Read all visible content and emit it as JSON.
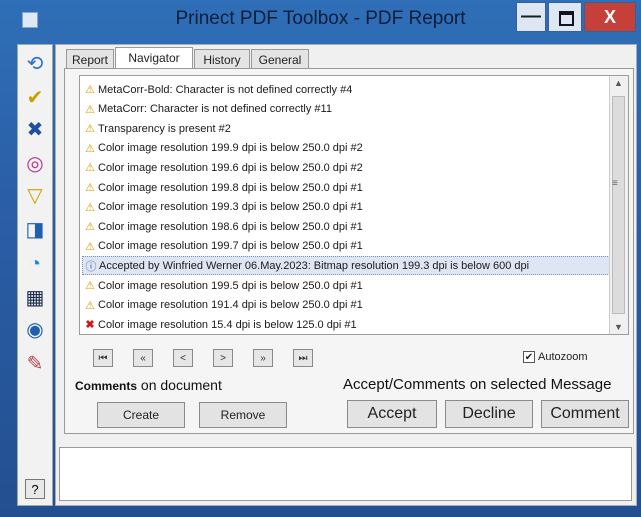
{
  "window": {
    "title": "Prinect PDF Toolbox - PDF Report",
    "minimize_label": "—",
    "close_label": "X"
  },
  "tabs": [
    {
      "label": "Report"
    },
    {
      "label": "Navigator"
    },
    {
      "label": "History"
    },
    {
      "label": "General"
    }
  ],
  "active_tab": "Navigator",
  "messages": [
    {
      "type": "warning",
      "text": "MetaCorr-Bold: Character is not defined correctly #4"
    },
    {
      "type": "warning",
      "text": "MetaCorr: Character is not defined correctly #11"
    },
    {
      "type": "warning",
      "text": "Transparency is present #2"
    },
    {
      "type": "warning",
      "text": "Color image resolution 199.9 dpi is below 250.0 dpi #2"
    },
    {
      "type": "warning",
      "text": "Color image resolution 199.6 dpi is below 250.0 dpi #2"
    },
    {
      "type": "warning",
      "text": "Color image resolution 199.8 dpi is below 250.0 dpi #1"
    },
    {
      "type": "warning",
      "text": "Color image resolution 199.3 dpi is below 250.0 dpi #1"
    },
    {
      "type": "warning",
      "text": "Color image resolution 198.6 dpi is below 250.0 dpi #1"
    },
    {
      "type": "warning",
      "text": "Color image resolution 199.7 dpi is below 250.0 dpi #1"
    },
    {
      "type": "accepted",
      "text": "Accepted by Winfried Werner 06.May.2023: Bitmap resolution 199.3 dpi is below 600 dpi"
    },
    {
      "type": "warning",
      "text": "Color image resolution 199.5 dpi is below 250.0 dpi #1"
    },
    {
      "type": "warning",
      "text": "Color image resolution 191.4 dpi is below 250.0 dpi #1"
    },
    {
      "type": "error",
      "text": "Color image resolution 15.4 dpi is below 125.0 dpi #1"
    }
  ],
  "icons": {
    "warning": "⚠",
    "error": "✖",
    "accepted": "ⓘ"
  },
  "icon_colors": {
    "warning": "#d89a00",
    "error": "#d01818",
    "accepted": "#3a5fb0"
  },
  "navigation": {
    "first": "⏮",
    "prev_fast": "«",
    "prev": "<",
    "next": ">",
    "next_fast": "»",
    "last": "⏭"
  },
  "autozoom": {
    "label": "Autozoom",
    "checked": true,
    "check_glyph": "✔"
  },
  "comments": {
    "strong_label": "Comments",
    "label_rest": " on document",
    "create_label": "Create",
    "remove_label": "Remove"
  },
  "accept_section": {
    "label": "Accept/Comments on selected Message",
    "accept_label": "Accept",
    "decline_label": "Decline",
    "comment_label": "Comment"
  },
  "help_label": "?",
  "toolbar_icons": [
    "profile-icon",
    "check-icon",
    "tools-icon",
    "color-wheel-icon",
    "fold-icon",
    "preview-icon",
    "pie-icon",
    "grid-icon",
    "search-icon",
    "edit-icon"
  ],
  "toolbar_glyphs": [
    "⟲",
    "✔",
    "✖",
    "◎",
    "▽",
    "◨",
    "◔",
    "▦",
    "◉",
    "✎"
  ],
  "scrollbar": {
    "up": "▲",
    "down": "▼",
    "grip": "≡"
  }
}
